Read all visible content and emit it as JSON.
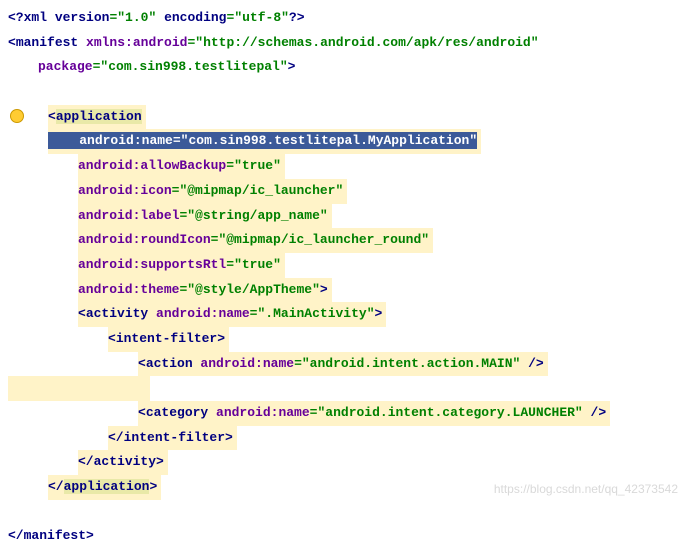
{
  "chart_data": {
    "type": "table",
    "title": "AndroidManifest.xml source",
    "lines": [
      "<?xml version=\"1.0\" encoding=\"utf-8\"?>",
      "<manifest xmlns:android=\"http://schemas.android.com/apk/res/android\"",
      "    package=\"com.sin998.testlitepal\">",
      "",
      "    <application",
      "        android:name=\"com.sin998.testlitepal.MyApplication\"",
      "        android:allowBackup=\"true\"",
      "        android:icon=\"@mipmap/ic_launcher\"",
      "        android:label=\"@string/app_name\"",
      "        android:roundIcon=\"@mipmap/ic_launcher_round\"",
      "        android:supportsRtl=\"true\"",
      "        android:theme=\"@style/AppTheme\">",
      "        <activity android:name=\".MainActivity\">",
      "            <intent-filter>",
      "                <action android:name=\"android.intent.action.MAIN\" />",
      "",
      "                <category android:name=\"android.intent.category.LAUNCHER\" />",
      "            </intent-filter>",
      "        </activity>",
      "    </application>",
      "",
      "</manifest>"
    ]
  },
  "l1": {
    "open": "<?",
    "tag": "xml version",
    "eq1": "=",
    "v1": "\"1.0\"",
    "sp": " ",
    "a2": "encoding",
    "eq2": "=",
    "v2": "\"utf-8\"",
    "close": "?>"
  },
  "l2": {
    "open": "<",
    "tag": "manifest ",
    "pfx": "xmlns:",
    "a": "android",
    "eq": "=",
    "v": "\"http://schemas.android.com/apk/res/android\""
  },
  "l3": {
    "a": "package",
    "eq": "=",
    "v": "\"com.sin998.testlitepal\"",
    "close": ">"
  },
  "l5": {
    "open": "<",
    "tag": "application"
  },
  "l6": {
    "pfx": "android:",
    "a": "name",
    "eq": "=",
    "v": "\"com.sin998.testlitepal.MyApplication\""
  },
  "l7": {
    "pfx": "android:",
    "a": "allowBackup",
    "eq": "=",
    "v": "\"true\""
  },
  "l8": {
    "pfx": "android:",
    "a": "icon",
    "eq": "=",
    "v": "\"@mipmap/ic_launcher\""
  },
  "l9": {
    "pfx": "android:",
    "a": "label",
    "eq": "=",
    "v": "\"@string/app_name\""
  },
  "l10": {
    "pfx": "android:",
    "a": "roundIcon",
    "eq": "=",
    "v": "\"@mipmap/ic_launcher_round\""
  },
  "l11": {
    "pfx": "android:",
    "a": "supportsRtl",
    "eq": "=",
    "v": "\"true\""
  },
  "l12": {
    "pfx": "android:",
    "a": "theme",
    "eq": "=",
    "v": "\"@style/AppTheme\"",
    "close": ">"
  },
  "l13": {
    "open": "<",
    "tag": "activity ",
    "pfx": "android:",
    "a": "name",
    "eq": "=",
    "v": "\".MainActivity\"",
    "close": ">"
  },
  "l14": {
    "open": "<",
    "tag": "intent-filter",
    "close": ">"
  },
  "l15": {
    "open": "<",
    "tag": "action ",
    "pfx": "android:",
    "a": "name",
    "eq": "=",
    "v": "\"android.intent.action.MAIN\"",
    "close": " />"
  },
  "l17": {
    "open": "<",
    "tag": "category ",
    "pfx": "android:",
    "a": "name",
    "eq": "=",
    "v": "\"android.intent.category.LAUNCHER\"",
    "close": " />"
  },
  "l18": {
    "open": "</",
    "tag": "intent-filter",
    "close": ">"
  },
  "l19": {
    "open": "</",
    "tag": "activity",
    "close": ">"
  },
  "l20": {
    "open": "</",
    "tag": "application",
    "close": ">"
  },
  "l22": {
    "open": "</",
    "tag": "manifest",
    "close": ">"
  },
  "watermark": "https://blog.csdn.net/qq_42373542"
}
